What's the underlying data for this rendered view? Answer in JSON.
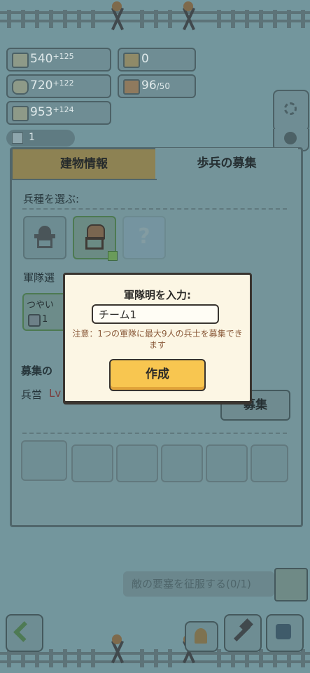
{
  "resources": {
    "food": {
      "value": "540",
      "rate": "+125",
      "icon": "wheat-icon"
    },
    "wood": {
      "value": "720",
      "rate": "+122",
      "icon": "log-icon"
    },
    "stone": {
      "value": "953",
      "rate": "+124",
      "icon": "stone-icon"
    },
    "gold": {
      "value": "0",
      "icon": "coin-icon"
    },
    "population": {
      "value": "96",
      "cap": "/50",
      "icon": "population-icon"
    },
    "gems": {
      "value": "1",
      "icon": "gem-icon"
    }
  },
  "tabs": {
    "building_info": "建物情報",
    "infantry_recruit": "歩兵の募集"
  },
  "panel": {
    "choose_type_label": "兵種を選ぶ:",
    "unknown_unit": "?",
    "army_select_label": "軍隊選",
    "army_card_name": "つやい",
    "army_card_count": "1",
    "recruit_label": "募集の",
    "barracks_label": "兵営",
    "barracks_level": "Lv",
    "recruit_button": "募集"
  },
  "modal": {
    "title": "軍隊明を入力:",
    "input_value": "チーム1",
    "note": "注意：1つの軍隊に最大9人の兵士を募集できます",
    "create_button": "作成"
  },
  "quest": {
    "text": "敵の要塞を征服する(0/1)"
  },
  "colors": {
    "modal_bg": "#fcf6e4",
    "create_button": "#f8c650",
    "active_tab": "#8d8253",
    "overlay": "#73969d"
  }
}
